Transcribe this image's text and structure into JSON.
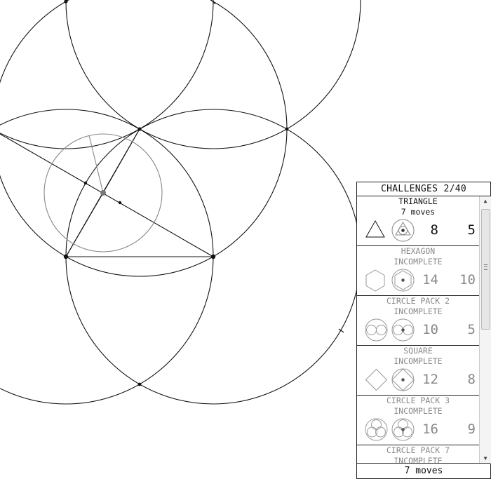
{
  "panel": {
    "title": "CHALLENGES 2/40",
    "footer": "7 moves"
  },
  "challenges": [
    {
      "name": "TRIANGLE",
      "status": "7 moves",
      "solved": true,
      "icon": "triangle-icon",
      "moves_l": "8",
      "moves_e": "5"
    },
    {
      "name": "HEXAGON",
      "status": "INCOMPLETE",
      "solved": false,
      "icon": "hexagon-icon",
      "moves_l": "14",
      "moves_e": "10"
    },
    {
      "name": "CIRCLE PACK 2",
      "status": "INCOMPLETE",
      "solved": false,
      "icon": "circle-pack-2-icon",
      "moves_l": "10",
      "moves_e": "5"
    },
    {
      "name": "SQUARE",
      "status": "INCOMPLETE",
      "solved": false,
      "icon": "square-icon",
      "moves_l": "12",
      "moves_e": "8"
    },
    {
      "name": "CIRCLE PACK 3",
      "status": "INCOMPLETE",
      "solved": false,
      "icon": "circle-pack-3-icon",
      "moves_l": "16",
      "moves_e": "9"
    },
    {
      "name": "CIRCLE PACK 7",
      "status": "INCOMPLETE",
      "solved": false,
      "icon": "circle-pack-7-icon",
      "moves_l": "",
      "moves_e": ""
    }
  ],
  "colors": {
    "construction_line": "#111111",
    "guide_line": "#888888",
    "solved_text": "#111111",
    "incomplete_text": "#888888"
  }
}
